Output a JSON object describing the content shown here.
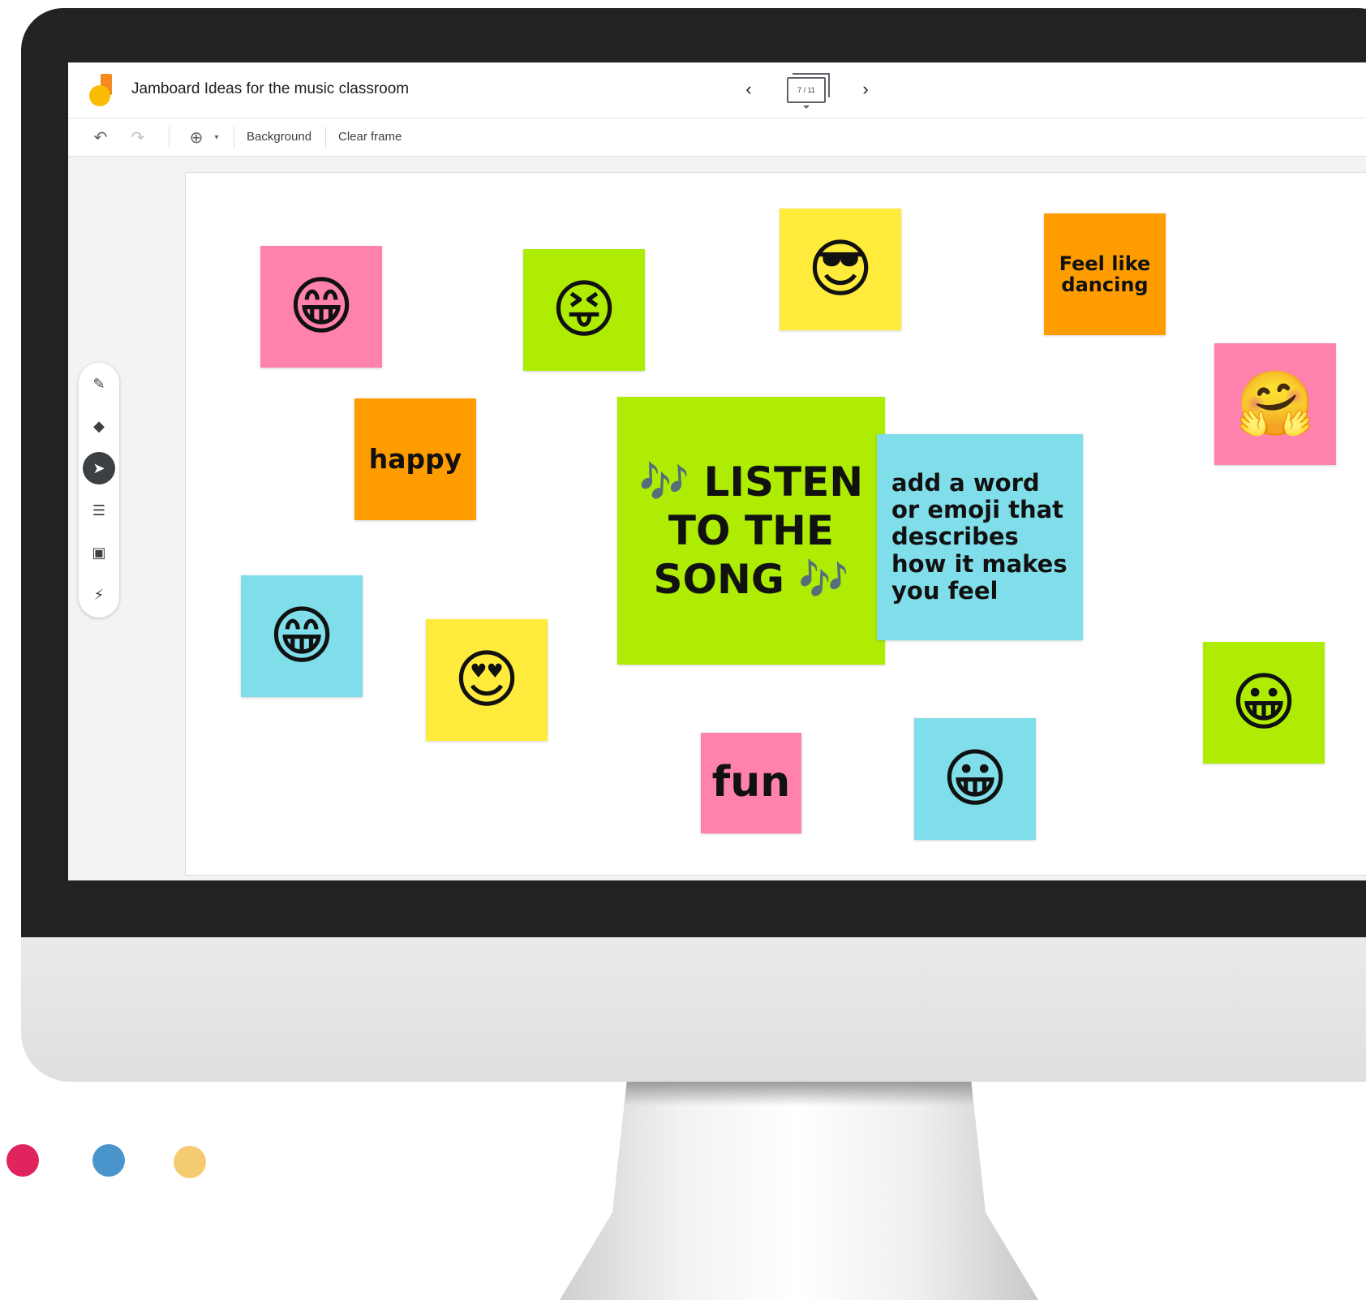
{
  "app": {
    "title": "Jamboard Ideas for the music classroom",
    "frame_indicator": "7 / 11"
  },
  "nav": {
    "prev_icon": "chevron-left-icon",
    "next_icon": "chevron-right-icon",
    "prev_glyph": "‹",
    "next_glyph": "›"
  },
  "toolbar": {
    "undo_glyph": "↶",
    "redo_glyph": "↷",
    "zoom_glyph": "⊕",
    "zoom_caret": "▾",
    "background_label": "Background",
    "clear_frame_label": "Clear frame"
  },
  "tools": [
    {
      "name": "pen-icon",
      "glyph": "✎"
    },
    {
      "name": "eraser-icon",
      "glyph": "◆"
    },
    {
      "name": "select-icon",
      "glyph": "➤",
      "active": true
    },
    {
      "name": "sticky-note-icon",
      "glyph": "☰"
    },
    {
      "name": "image-icon",
      "glyph": "▣"
    },
    {
      "name": "laser-icon",
      "glyph": "⚡"
    }
  ],
  "notes": {
    "grin_pink": "😁",
    "squint_tongue": "😝",
    "sunglasses": "😎",
    "feel_like_dancing": "Feel like dancing",
    "hugging": "🤗",
    "happy": "happy",
    "listen": "🎶 LISTEN TO THE SONG 🎶",
    "instructions": "add a word or emoji that describes how it makes you feel",
    "grin_cyan": "😁",
    "heart_eyes": "😍",
    "grinning_green": "😀",
    "fun": "fun",
    "grinning_cyan": "😀"
  },
  "colors": {
    "pink": "#ff82ae",
    "green": "#afec04",
    "yellow": "#ffeb3b",
    "orange": "#ff9c00",
    "cyan": "#80deea",
    "dot_red": "#e0245e",
    "dot_blue": "#4a94cc",
    "dot_yellow": "#f5cb72"
  }
}
